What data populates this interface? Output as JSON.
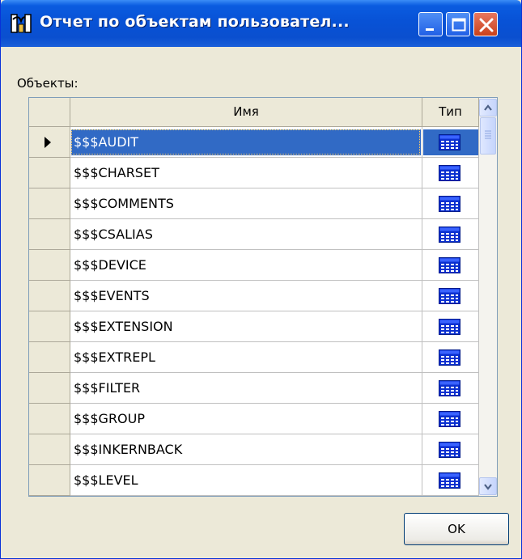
{
  "window": {
    "title": "Отчет по объектам пользовател...",
    "icon": "app-icon",
    "controls": {
      "minimize": "minimize-icon",
      "maximize": "maximize-icon",
      "close": "close-icon"
    }
  },
  "objects_label": "Объекты:",
  "grid": {
    "columns": {
      "name": "Имя",
      "type": "Тип"
    },
    "selected_row": 0,
    "rows": [
      {
        "name": "$$$AUDIT",
        "type_icon": "table-icon"
      },
      {
        "name": "$$$CHARSET",
        "type_icon": "table-icon"
      },
      {
        "name": "$$$COMMENTS",
        "type_icon": "table-icon"
      },
      {
        "name": "$$$CSALIAS",
        "type_icon": "table-icon"
      },
      {
        "name": "$$$DEVICE",
        "type_icon": "table-icon"
      },
      {
        "name": "$$$EVENTS",
        "type_icon": "table-icon"
      },
      {
        "name": "$$$EXTENSION",
        "type_icon": "table-icon"
      },
      {
        "name": "$$$EXTREPL",
        "type_icon": "table-icon"
      },
      {
        "name": "$$$FILTER",
        "type_icon": "table-icon"
      },
      {
        "name": "$$$GROUP",
        "type_icon": "table-icon"
      },
      {
        "name": "$$$INKERNBACK",
        "type_icon": "table-icon"
      },
      {
        "name": "$$$LEVEL",
        "type_icon": "table-icon"
      }
    ]
  },
  "ok_button": "OK",
  "colors": {
    "selection": "#316ac5",
    "titlebar": "#0852d6",
    "dialog_bg": "#ece9d8"
  }
}
